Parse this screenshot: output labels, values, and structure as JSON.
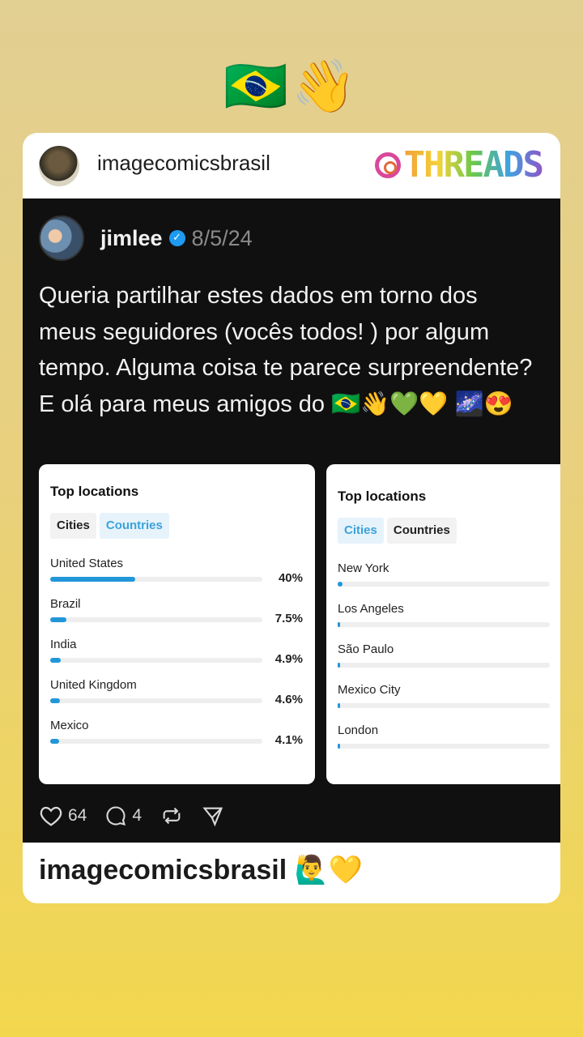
{
  "story": {
    "top_emojis": "🇧🇷👋"
  },
  "card": {
    "username": "imagecomicsbrasil",
    "badge_text": "THREADS",
    "caption": "imagecomicsbrasil 🙋‍♂️💛"
  },
  "post": {
    "author": "jimlee",
    "verified_icon": "verified-badge-icon",
    "date": "8/5/24",
    "text": "Queria partilhar estes dados em torno dos meus seguidores (vocês todos! ) por algum tempo. Alguma coisa te parece surpreendente? E olá para meus amigos do 🇧🇷👋💚💛 🌌😍",
    "likes": "64",
    "comments": "4"
  },
  "panels": {
    "left": {
      "title": "Top locations",
      "tabs": [
        "Cities",
        "Countries"
      ],
      "active_tab": "Countries",
      "locations": [
        {
          "name": "United States",
          "pct": "40%",
          "value": 40
        },
        {
          "name": "Brazil",
          "pct": "7.5%",
          "value": 7.5
        },
        {
          "name": "India",
          "pct": "4.9%",
          "value": 4.9
        },
        {
          "name": "United Kingdom",
          "pct": "4.6%",
          "value": 4.6
        },
        {
          "name": "Mexico",
          "pct": "4.1%",
          "value": 4.1
        }
      ]
    },
    "right": {
      "title": "Top locations",
      "tabs": [
        "Cities",
        "Countries"
      ],
      "active_tab": "Cities",
      "locations": [
        {
          "name": "New York",
          "value": 2.2
        },
        {
          "name": "Los Angeles",
          "value": 0.7
        },
        {
          "name": "São Paulo",
          "value": 0.6
        },
        {
          "name": "Mexico City",
          "value": 0.6
        },
        {
          "name": "London",
          "value": 0.5
        }
      ]
    }
  },
  "colors": {
    "bar": "#2196d8",
    "active_tab_text": "#3aa3db",
    "verified": "#1d9bf0"
  }
}
